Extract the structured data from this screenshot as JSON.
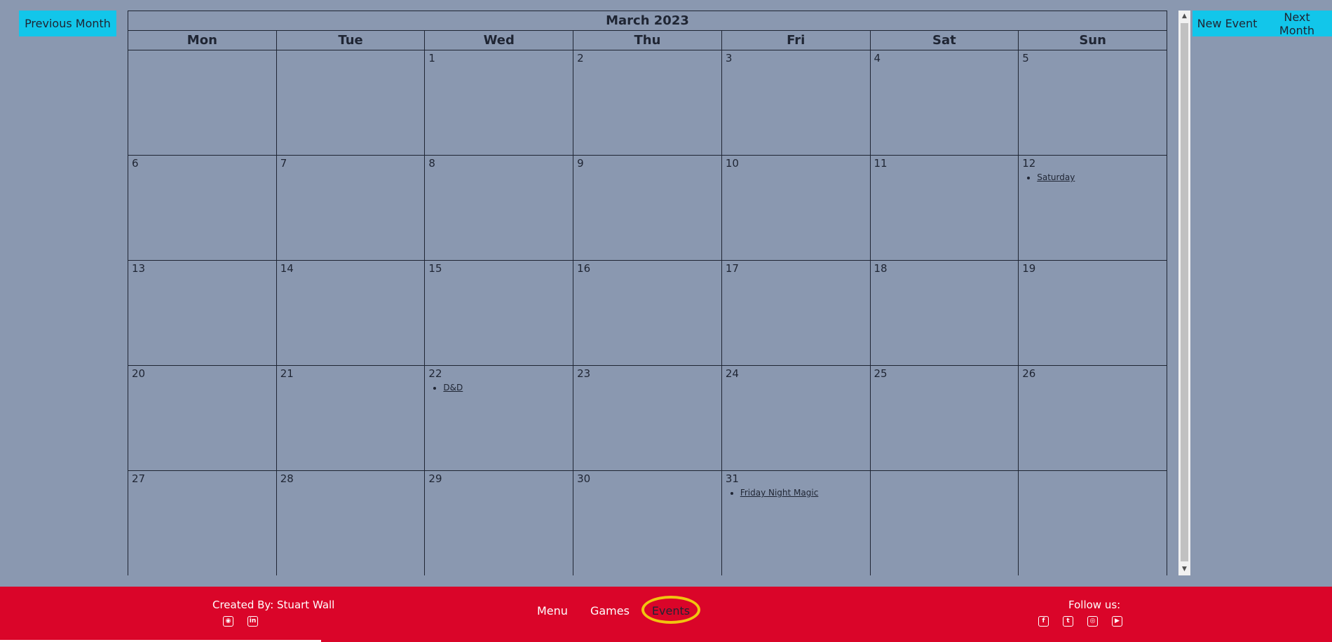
{
  "toolbar": {
    "prev_label": "Previous Month",
    "new_event_label": "New Event",
    "next_label": "Next Month"
  },
  "calendar": {
    "title": "March 2023",
    "weekdays": [
      "Mon",
      "Tue",
      "Wed",
      "Thu",
      "Fri",
      "Sat",
      "Sun"
    ],
    "weeks": [
      [
        {
          "day": ""
        },
        {
          "day": ""
        },
        {
          "day": "1"
        },
        {
          "day": "2"
        },
        {
          "day": "3"
        },
        {
          "day": "4"
        },
        {
          "day": "5"
        }
      ],
      [
        {
          "day": "6"
        },
        {
          "day": "7"
        },
        {
          "day": "8"
        },
        {
          "day": "9"
        },
        {
          "day": "10"
        },
        {
          "day": "11"
        },
        {
          "day": "12",
          "events": [
            "Saturday"
          ]
        }
      ],
      [
        {
          "day": "13"
        },
        {
          "day": "14"
        },
        {
          "day": "15"
        },
        {
          "day": "16"
        },
        {
          "day": "17"
        },
        {
          "day": "18"
        },
        {
          "day": "19"
        }
      ],
      [
        {
          "day": "20"
        },
        {
          "day": "21"
        },
        {
          "day": "22",
          "events": [
            "D&D"
          ]
        },
        {
          "day": "23"
        },
        {
          "day": "24"
        },
        {
          "day": "25"
        },
        {
          "day": "26"
        }
      ],
      [
        {
          "day": "27"
        },
        {
          "day": "28"
        },
        {
          "day": "29"
        },
        {
          "day": "30"
        },
        {
          "day": "31",
          "events": [
            "Friday Night Magic"
          ]
        },
        {
          "day": ""
        },
        {
          "day": ""
        }
      ]
    ]
  },
  "footer": {
    "credit": "Created By: Stuart Wall",
    "credit_icons": [
      "github-icon",
      "linkedin-icon"
    ],
    "nav": [
      {
        "label": "Menu",
        "active": false
      },
      {
        "label": "Games",
        "active": false
      },
      {
        "label": "Events",
        "active": true
      }
    ],
    "follow_label": "Follow us:",
    "social_icons": [
      "facebook-icon",
      "twitter-icon",
      "instagram-icon",
      "youtube-icon"
    ]
  },
  "colors": {
    "page_bg": "#8a98b0",
    "button_bg": "#12c6ea",
    "footer_bg": "#da0529",
    "highlight_ring": "#f1c40f"
  }
}
